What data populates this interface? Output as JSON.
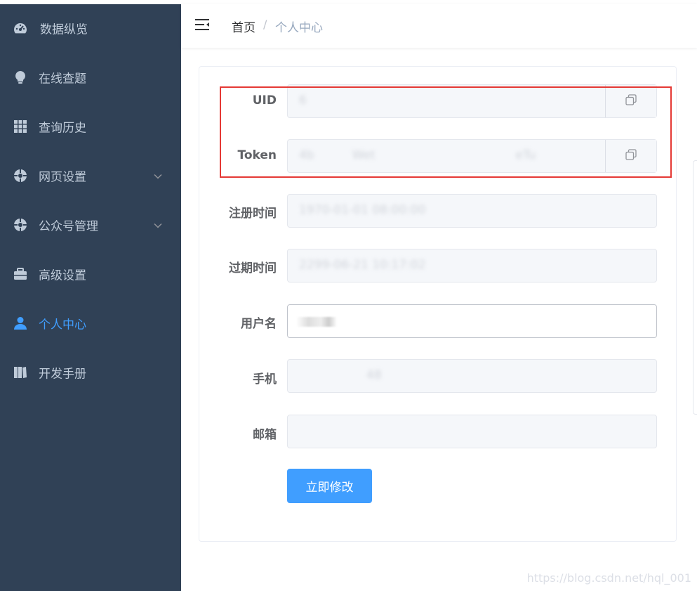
{
  "sidebar": {
    "items": [
      {
        "label": "数据纵览",
        "icon": "dashboard-icon"
      },
      {
        "label": "在线查题",
        "icon": "lightbulb-icon"
      },
      {
        "label": "查询历史",
        "icon": "grid-icon"
      },
      {
        "label": "网页设置",
        "icon": "settings-circle-icon",
        "expandable": true
      },
      {
        "label": "公众号管理",
        "icon": "settings-circle-icon",
        "expandable": true
      },
      {
        "label": "高级设置",
        "icon": "briefcase-icon"
      },
      {
        "label": "个人中心",
        "icon": "user-icon",
        "active": true
      },
      {
        "label": "开发手册",
        "icon": "book-icon"
      }
    ]
  },
  "breadcrumb": {
    "home": "首页",
    "separator": "/",
    "current": "个人中心"
  },
  "form": {
    "uid": {
      "label": "UID",
      "value": "6"
    },
    "token": {
      "label": "Token",
      "value": "4b          Wet                                     eTu"
    },
    "register_time": {
      "label": "注册时间",
      "value": "1970-01-01 08:00:00"
    },
    "expire_time": {
      "label": "过期时间",
      "value": "2299-06-21 10:17:02"
    },
    "username": {
      "label": "用户名",
      "value": ""
    },
    "phone": {
      "label": "手机",
      "value": "48"
    },
    "email": {
      "label": "邮箱",
      "value": ""
    },
    "submit_label": "立即修改"
  },
  "watermark": "https://blog.csdn.net/hql_001",
  "colors": {
    "sidebar_bg": "#304156",
    "sidebar_text": "#bfcbd9",
    "active": "#409eff",
    "highlight": "#e53935"
  }
}
